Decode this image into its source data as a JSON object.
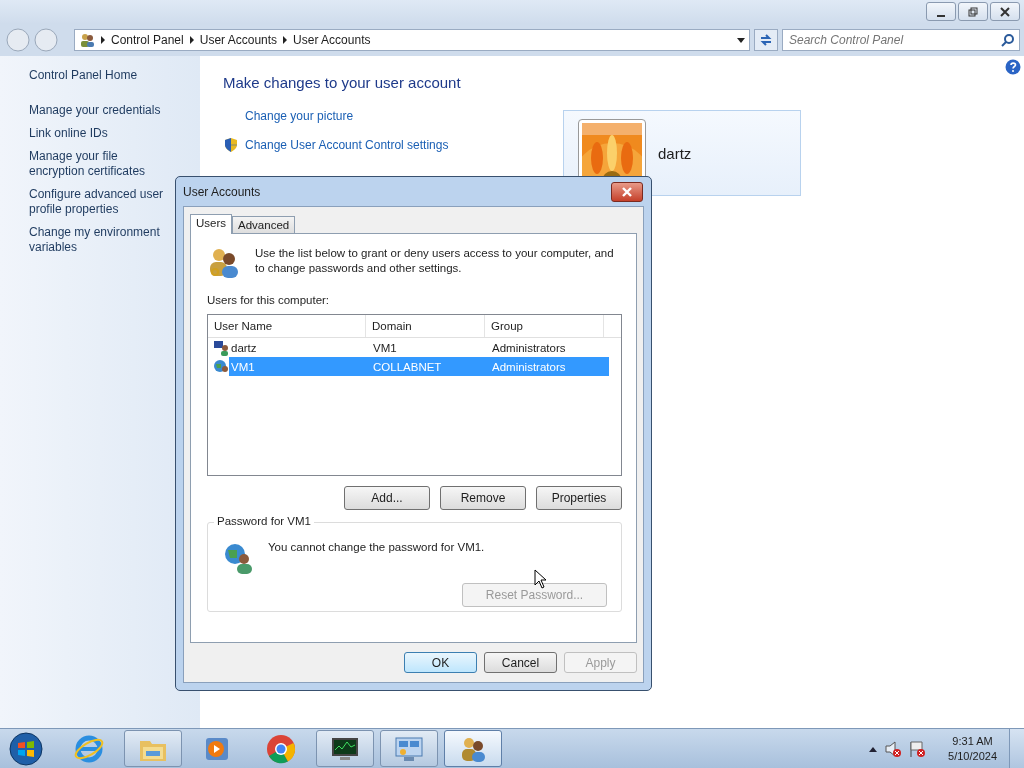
{
  "address_bar": {
    "breadcrumbs": [
      "Control Panel",
      "User Accounts",
      "User Accounts"
    ]
  },
  "search": {
    "placeholder": "Search Control Panel"
  },
  "sidebar": {
    "home": "Control Panel Home",
    "links": [
      "Manage your credentials",
      "Link online IDs",
      "Manage your file encryption certificates",
      "Configure advanced user profile properties",
      "Change my environment variables"
    ]
  },
  "content": {
    "title": "Make changes to your user account",
    "tasks": [
      {
        "label": "Change your picture",
        "shield": false
      },
      {
        "label": "Change User Account Control settings",
        "shield": true
      }
    ]
  },
  "account": {
    "name": "dartz"
  },
  "dialog": {
    "title": "User Accounts",
    "tabs": [
      {
        "label": "Users",
        "selected": true
      },
      {
        "label": "Advanced",
        "selected": false
      }
    ],
    "intro": "Use the list below to grant or deny users access to your computer, and to change passwords and other settings.",
    "list_label": "Users for this computer:",
    "columns": [
      "User Name",
      "Domain",
      "Group"
    ],
    "rows": [
      {
        "kind": "local",
        "selected": false,
        "cells": [
          "dartz",
          "VM1",
          "Administrators"
        ]
      },
      {
        "kind": "domain",
        "selected": true,
        "cells": [
          "VM1",
          "COLLABNET",
          "Administrators"
        ]
      }
    ],
    "list_buttons": [
      {
        "label": "Add...",
        "disabled": false
      },
      {
        "label": "Remove",
        "disabled": false
      },
      {
        "label": "Properties",
        "disabled": false
      }
    ],
    "password_group": {
      "title": "Password for VM1",
      "message": "You cannot change the password for VM1.",
      "button": {
        "label": "Reset Password...",
        "disabled": true
      }
    },
    "buttons": [
      {
        "label": "OK",
        "disabled": false,
        "default": true
      },
      {
        "label": "Cancel",
        "disabled": false,
        "default": false
      },
      {
        "label": "Apply",
        "disabled": true,
        "default": false
      }
    ]
  },
  "taskbar": {
    "apps": [
      {
        "kind": "browser-e",
        "open": false,
        "active": false
      },
      {
        "kind": "folder",
        "open": true,
        "active": false
      },
      {
        "kind": "player",
        "open": false,
        "active": false
      },
      {
        "kind": "browser-c",
        "open": false,
        "active": false
      },
      {
        "kind": "monitor",
        "open": true,
        "active": false
      },
      {
        "kind": "panel",
        "open": true,
        "active": false
      },
      {
        "kind": "users",
        "open": true,
        "active": true
      }
    ],
    "clock": {
      "time": "9:31 AM",
      "date": "5/10/2024"
    }
  }
}
